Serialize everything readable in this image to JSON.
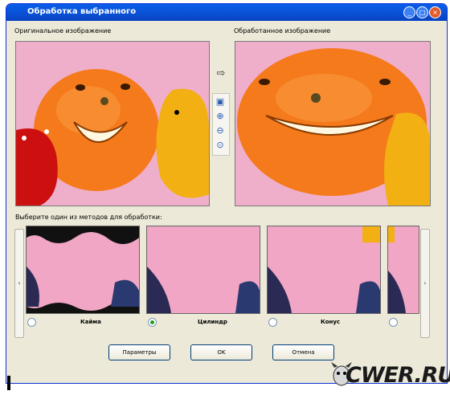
{
  "window": {
    "title": "Обработка выбранного",
    "controls": [
      "minimize",
      "maximize",
      "close"
    ]
  },
  "labels": {
    "original": "Оригинальное изображение",
    "processed": "Обработанное изображение",
    "choose_method": "Выберите один из методов для обработки:"
  },
  "tools": {
    "arrow_icon": "arrow-right-icon",
    "fit_icon": "fit-to-window-icon",
    "zoom_in_icon": "zoom-in-icon",
    "zoom_out_icon": "zoom-out-icon",
    "zoom_icon": "zoom-icon"
  },
  "methods": [
    {
      "label": "Кайма",
      "selected": false
    },
    {
      "label": "Цилиндр",
      "selected": true
    },
    {
      "label": "Конус",
      "selected": false
    },
    {
      "label": "",
      "selected": false
    }
  ],
  "buttons": {
    "params": "Параметры",
    "ok": "OK",
    "cancel": "Отмена"
  },
  "watermark": "CWER.RU",
  "colors": {
    "titlebar": "#0a52d8",
    "dialog_bg": "#ece9d8",
    "pink_bg": "#efafca",
    "orange": "#f47a1c"
  }
}
